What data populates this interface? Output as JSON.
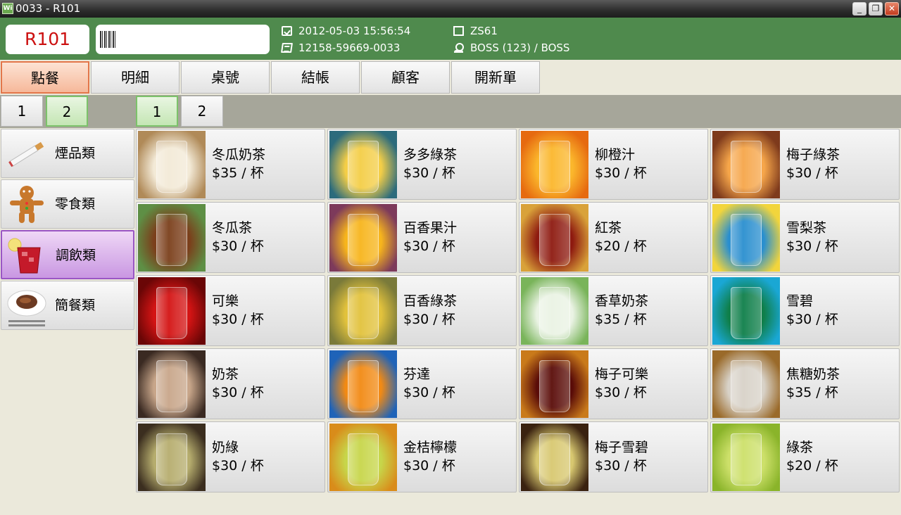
{
  "window": {
    "title": "0033 - R101",
    "app_icon_text": "Wi",
    "buttons": {
      "minimize": "_",
      "restore": "❐",
      "close": "✕"
    }
  },
  "header": {
    "table_number": "R101",
    "barcode_value": "",
    "datetime": "2012-05-03 15:56:54",
    "order_number": "12158-59669-0033",
    "station": "ZS61",
    "user": "BOSS (123) / BOSS"
  },
  "tabs": [
    "點餐",
    "明細",
    "桌號",
    "結帳",
    "顧客",
    "開新單"
  ],
  "active_tab_index": 0,
  "category_pages": [
    "1",
    "2"
  ],
  "active_category_page_index": 1,
  "item_pages": [
    "1",
    "2"
  ],
  "active_item_page_index": 0,
  "categories": [
    {
      "label": "煙品類",
      "icon": "cigarette-icon"
    },
    {
      "label": "零食類",
      "icon": "gingerbread-icon"
    },
    {
      "label": "調飲類",
      "icon": "cocktail-icon"
    },
    {
      "label": "簡餐類",
      "icon": "meal-plate-icon"
    }
  ],
  "active_category_index": 2,
  "products": [
    {
      "name": "冬瓜奶茶",
      "price": "$35 / 杯",
      "image": "wintermelon-milk-tea-photo",
      "colors": [
        "#f3ead7",
        "#b08a58"
      ]
    },
    {
      "name": "多多綠茶",
      "price": "$30 / 杯",
      "image": "yakult-green-tea-photo",
      "colors": [
        "#f4ce47",
        "#2c6b7c"
      ]
    },
    {
      "name": "柳橙汁",
      "price": "$30 / 杯",
      "image": "orange-juice-photo",
      "colors": [
        "#fbb72c",
        "#e66a10"
      ]
    },
    {
      "name": "梅子綠茶",
      "price": "$30 / 杯",
      "image": "plum-green-tea-photo",
      "colors": [
        "#f6a64a",
        "#7e3a1c"
      ]
    },
    {
      "name": "冬瓜茶",
      "price": "$30 / 杯",
      "image": "wintermelon-tea-photo",
      "colors": [
        "#7b3f1b",
        "#5e8f45"
      ]
    },
    {
      "name": "百香果汁",
      "price": "$30 / 杯",
      "image": "passion-fruit-juice-photo",
      "colors": [
        "#f7b51c",
        "#7d3a5b"
      ]
    },
    {
      "name": "紅茶",
      "price": "$20 / 杯",
      "image": "black-tea-photo",
      "colors": [
        "#8e1a10",
        "#d9a23a"
      ]
    },
    {
      "name": "雪梨茶",
      "price": "$30 / 杯",
      "image": "snow-pear-tea-photo",
      "colors": [
        "#2a8fcf",
        "#f2d53c"
      ]
    },
    {
      "name": "可樂",
      "price": "$30 / 杯",
      "image": "coca-cola-photo",
      "colors": [
        "#d41414",
        "#6a0606"
      ]
    },
    {
      "name": "百香綠茶",
      "price": "$30 / 杯",
      "image": "passion-green-tea-photo",
      "colors": [
        "#e2c23c",
        "#7a7a3a"
      ]
    },
    {
      "name": "香草奶茶",
      "price": "$35 / 杯",
      "image": "vanilla-milk-tea-photo",
      "colors": [
        "#eaf3e4",
        "#79b45a"
      ]
    },
    {
      "name": "雪碧",
      "price": "$30 / 杯",
      "image": "sprite-photo",
      "colors": [
        "#0f7f4a",
        "#1aa7d4"
      ]
    },
    {
      "name": "奶茶",
      "price": "$30 / 杯",
      "image": "milk-tea-photo",
      "colors": [
        "#c8a68a",
        "#3a2a22"
      ]
    },
    {
      "name": "芬達",
      "price": "$30 / 杯",
      "image": "fanta-photo",
      "colors": [
        "#f28a14",
        "#1f63b8"
      ]
    },
    {
      "name": "梅子可樂",
      "price": "$30 / 杯",
      "image": "plum-cola-photo",
      "colors": [
        "#5a0c08",
        "#c97a1a"
      ]
    },
    {
      "name": "焦糖奶茶",
      "price": "$35 / 杯",
      "image": "caramel-milk-tea-photo",
      "colors": [
        "#d8d2c8",
        "#9a6a2a"
      ]
    },
    {
      "name": "奶綠",
      "price": "$30 / 杯",
      "image": "milk-green-tea-photo",
      "colors": [
        "#b6ad6e",
        "#3b2e1f"
      ]
    },
    {
      "name": "金桔檸檬",
      "price": "$30 / 杯",
      "image": "kumquat-lemon-photo",
      "colors": [
        "#c7d64a",
        "#d98c1a"
      ]
    },
    {
      "name": "梅子雪碧",
      "price": "$30 / 杯",
      "image": "plum-sprite-photo",
      "colors": [
        "#d8c870",
        "#3a2210"
      ]
    },
    {
      "name": "綠茶",
      "price": "$20 / 杯",
      "image": "green-tea-photo",
      "colors": [
        "#cde06a",
        "#8ab42a"
      ]
    }
  ],
  "theme": {
    "header_green": "#4f8a4d",
    "active_tab": "#f6b89a",
    "active_page": "#c4e6b4",
    "active_category": "#c997e2",
    "table_number_red": "#cc1010"
  }
}
